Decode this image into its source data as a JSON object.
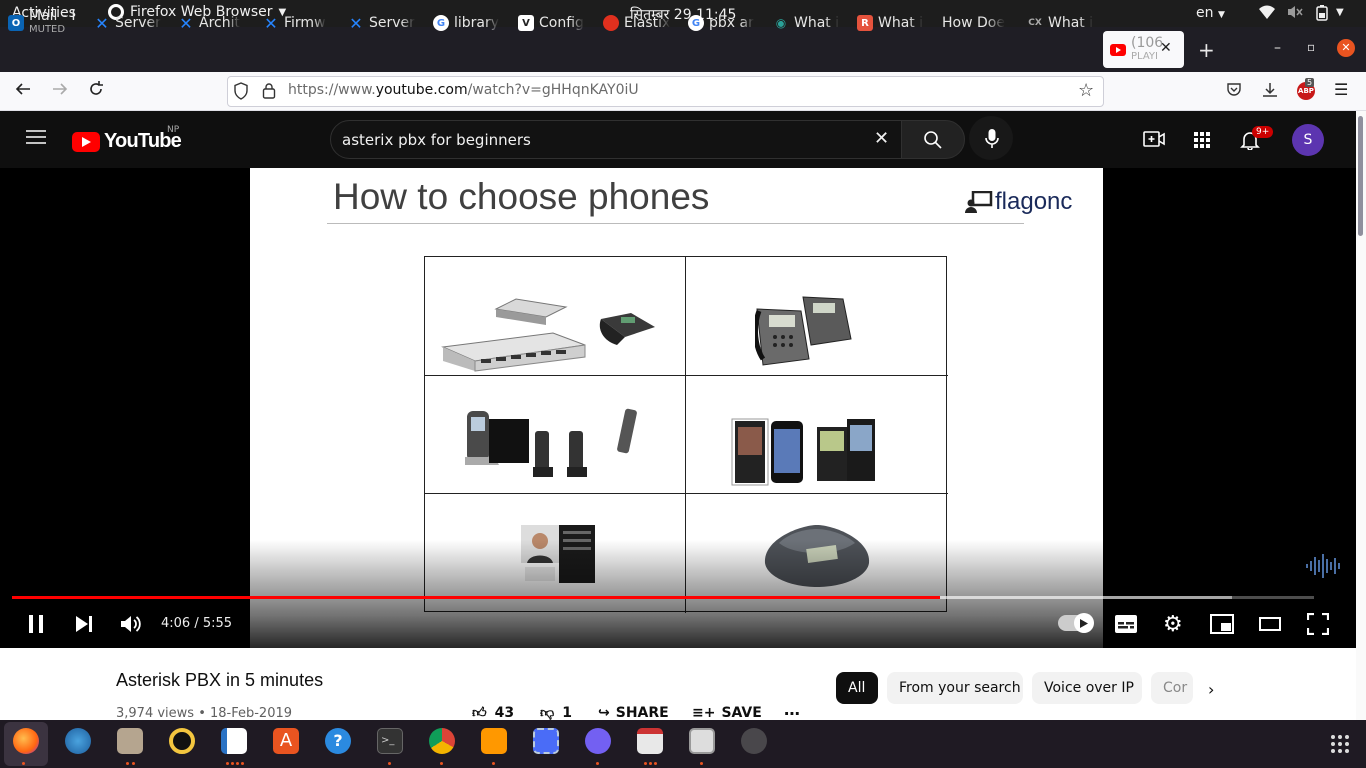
{
  "system": {
    "activities": "Activities",
    "app_name": "Firefox Web Browser",
    "clock": "सितम्बर 29  11:45",
    "lang": "en"
  },
  "tabs": [
    {
      "label": "Mail - I",
      "sub": "MUTED",
      "color": "#0a64b4"
    },
    {
      "label": "Server",
      "color": "#2684ff"
    },
    {
      "label": "Archit",
      "color": "#2684ff"
    },
    {
      "label": "Firmw",
      "color": "#2684ff"
    },
    {
      "label": "Server",
      "color": "#2684ff"
    },
    {
      "label": "library",
      "color": "#ffffff"
    },
    {
      "label": "Config",
      "color": "#ffffff"
    },
    {
      "label": "Elastix",
      "color": "#e0301e"
    },
    {
      "label": "pbx ar",
      "color": "#ffffff"
    },
    {
      "label": "What i",
      "color": "#2aa198"
    },
    {
      "label": "What i",
      "color": "#e5533d"
    },
    {
      "label": "How Doe",
      "color": ""
    },
    {
      "label": "What i",
      "color": "#888888"
    },
    {
      "label": "(106",
      "sub": "PLAYI",
      "color": "#ff0000",
      "active": true
    }
  ],
  "nav": {
    "url_prefix": "https://www.",
    "url_domain": "youtube.com",
    "url_path": "/watch?v=gHHqnKAY0iU",
    "abp_count": "5"
  },
  "youtube": {
    "logo_text": "YouTube",
    "country": "NP",
    "search_value": "asterix pbx for beginners",
    "notif_count": "9+",
    "avatar_letter": "S"
  },
  "slide": {
    "title": "How to choose phones",
    "brand": "flagonc"
  },
  "player": {
    "time_current": "4:06",
    "time_sep": " / ",
    "time_total": "5:55",
    "progress_played_pct": 71.3,
    "progress_loaded_pct": 93.7
  },
  "video": {
    "title": "Asterisk PBX in 5 minutes",
    "stats": "3,974 views • 18-Feb-2019",
    "likes": "43",
    "dislikes": "1",
    "share": "SHARE",
    "save": "SAVE"
  },
  "chips": [
    "All",
    "From your search",
    "Voice over IP",
    "Cor"
  ]
}
